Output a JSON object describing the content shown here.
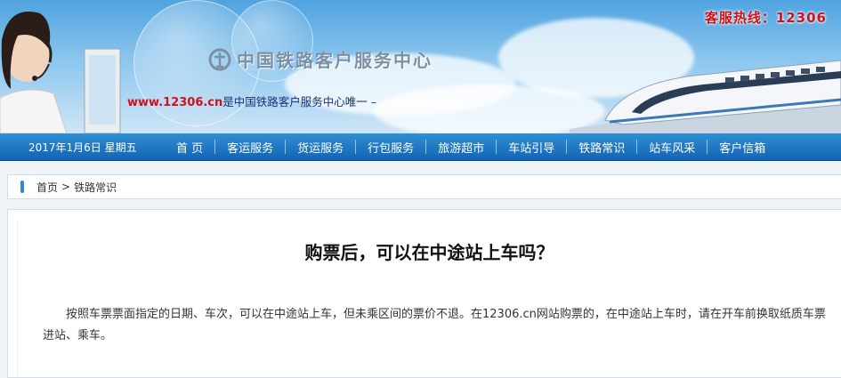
{
  "header": {
    "hotline": "客服热线：12306",
    "center_name": "中国铁路客户服务中心",
    "site_url": "www.12306.cn",
    "site_tagline": "是中国铁路客户服务中心唯一",
    "icons": [
      "headset-agent-icon",
      "railway-logo-icon",
      "train-icon"
    ]
  },
  "nav": {
    "date": "2017年1月6日 星期五",
    "items": [
      "首 页",
      "客运服务",
      "货运服务",
      "行包服务",
      "旅游超市",
      "车站引导",
      "铁路常识",
      "站车风采",
      "客户信箱"
    ]
  },
  "breadcrumb": {
    "home": "首页",
    "separator": ">",
    "current": "铁路常识"
  },
  "article": {
    "title": "购票后，可以在中途站上车吗？",
    "body": "按照车票票面指定的日期、车次，可以在中途站上车，但未乘区间的票价不退。在12306.cn网站购票的，在中途站上车时，请在开车前换取纸质车票进站、乘车。"
  },
  "colors": {
    "nav_bg": "#1a6fbf",
    "hotline": "#d0101a",
    "accent": "#2d8ad7"
  }
}
